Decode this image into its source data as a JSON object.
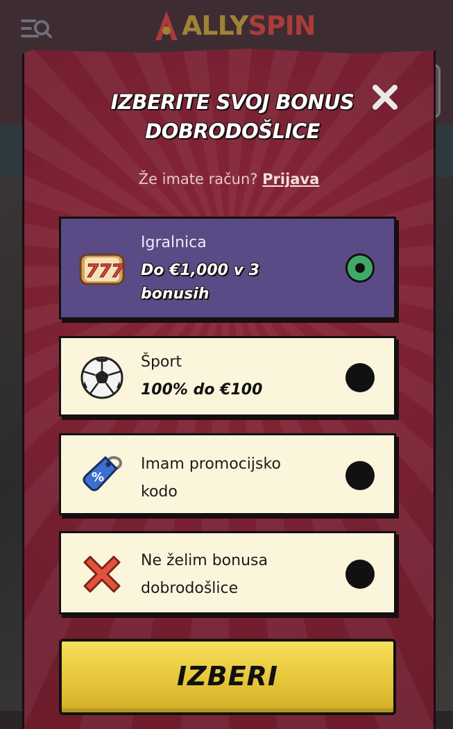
{
  "site": {
    "logo_text_a": "ALLY",
    "logo_text_b": "SPIN"
  },
  "modal": {
    "title": "IZBERITE SVOJ BONUS DOBRODOŠLICE",
    "login_prompt": "Že imate račun?",
    "login_link": "Prijava",
    "options": [
      {
        "label": "Igralnica",
        "sub": "Do €1,000 v 3 bonusih",
        "icon": "slot-777-icon",
        "selected": true
      },
      {
        "label": "Šport",
        "sub": "100% do €100",
        "icon": "soccer-ball-icon",
        "selected": false
      },
      {
        "label": "Imam promocijsko kodo",
        "sub": "",
        "icon": "promo-tag-icon",
        "selected": false
      },
      {
        "label": "Ne želim bonusa dobrodošlice",
        "sub": "",
        "icon": "red-x-icon",
        "selected": false
      }
    ],
    "cta_label": "IZBERI"
  },
  "colors": {
    "modal_bg": "#7b2132",
    "selected_option_bg": "#5a4a86",
    "option_bg": "#fbf5dc",
    "radio_selected": "#3fa968",
    "cta": "#e6c63a"
  }
}
